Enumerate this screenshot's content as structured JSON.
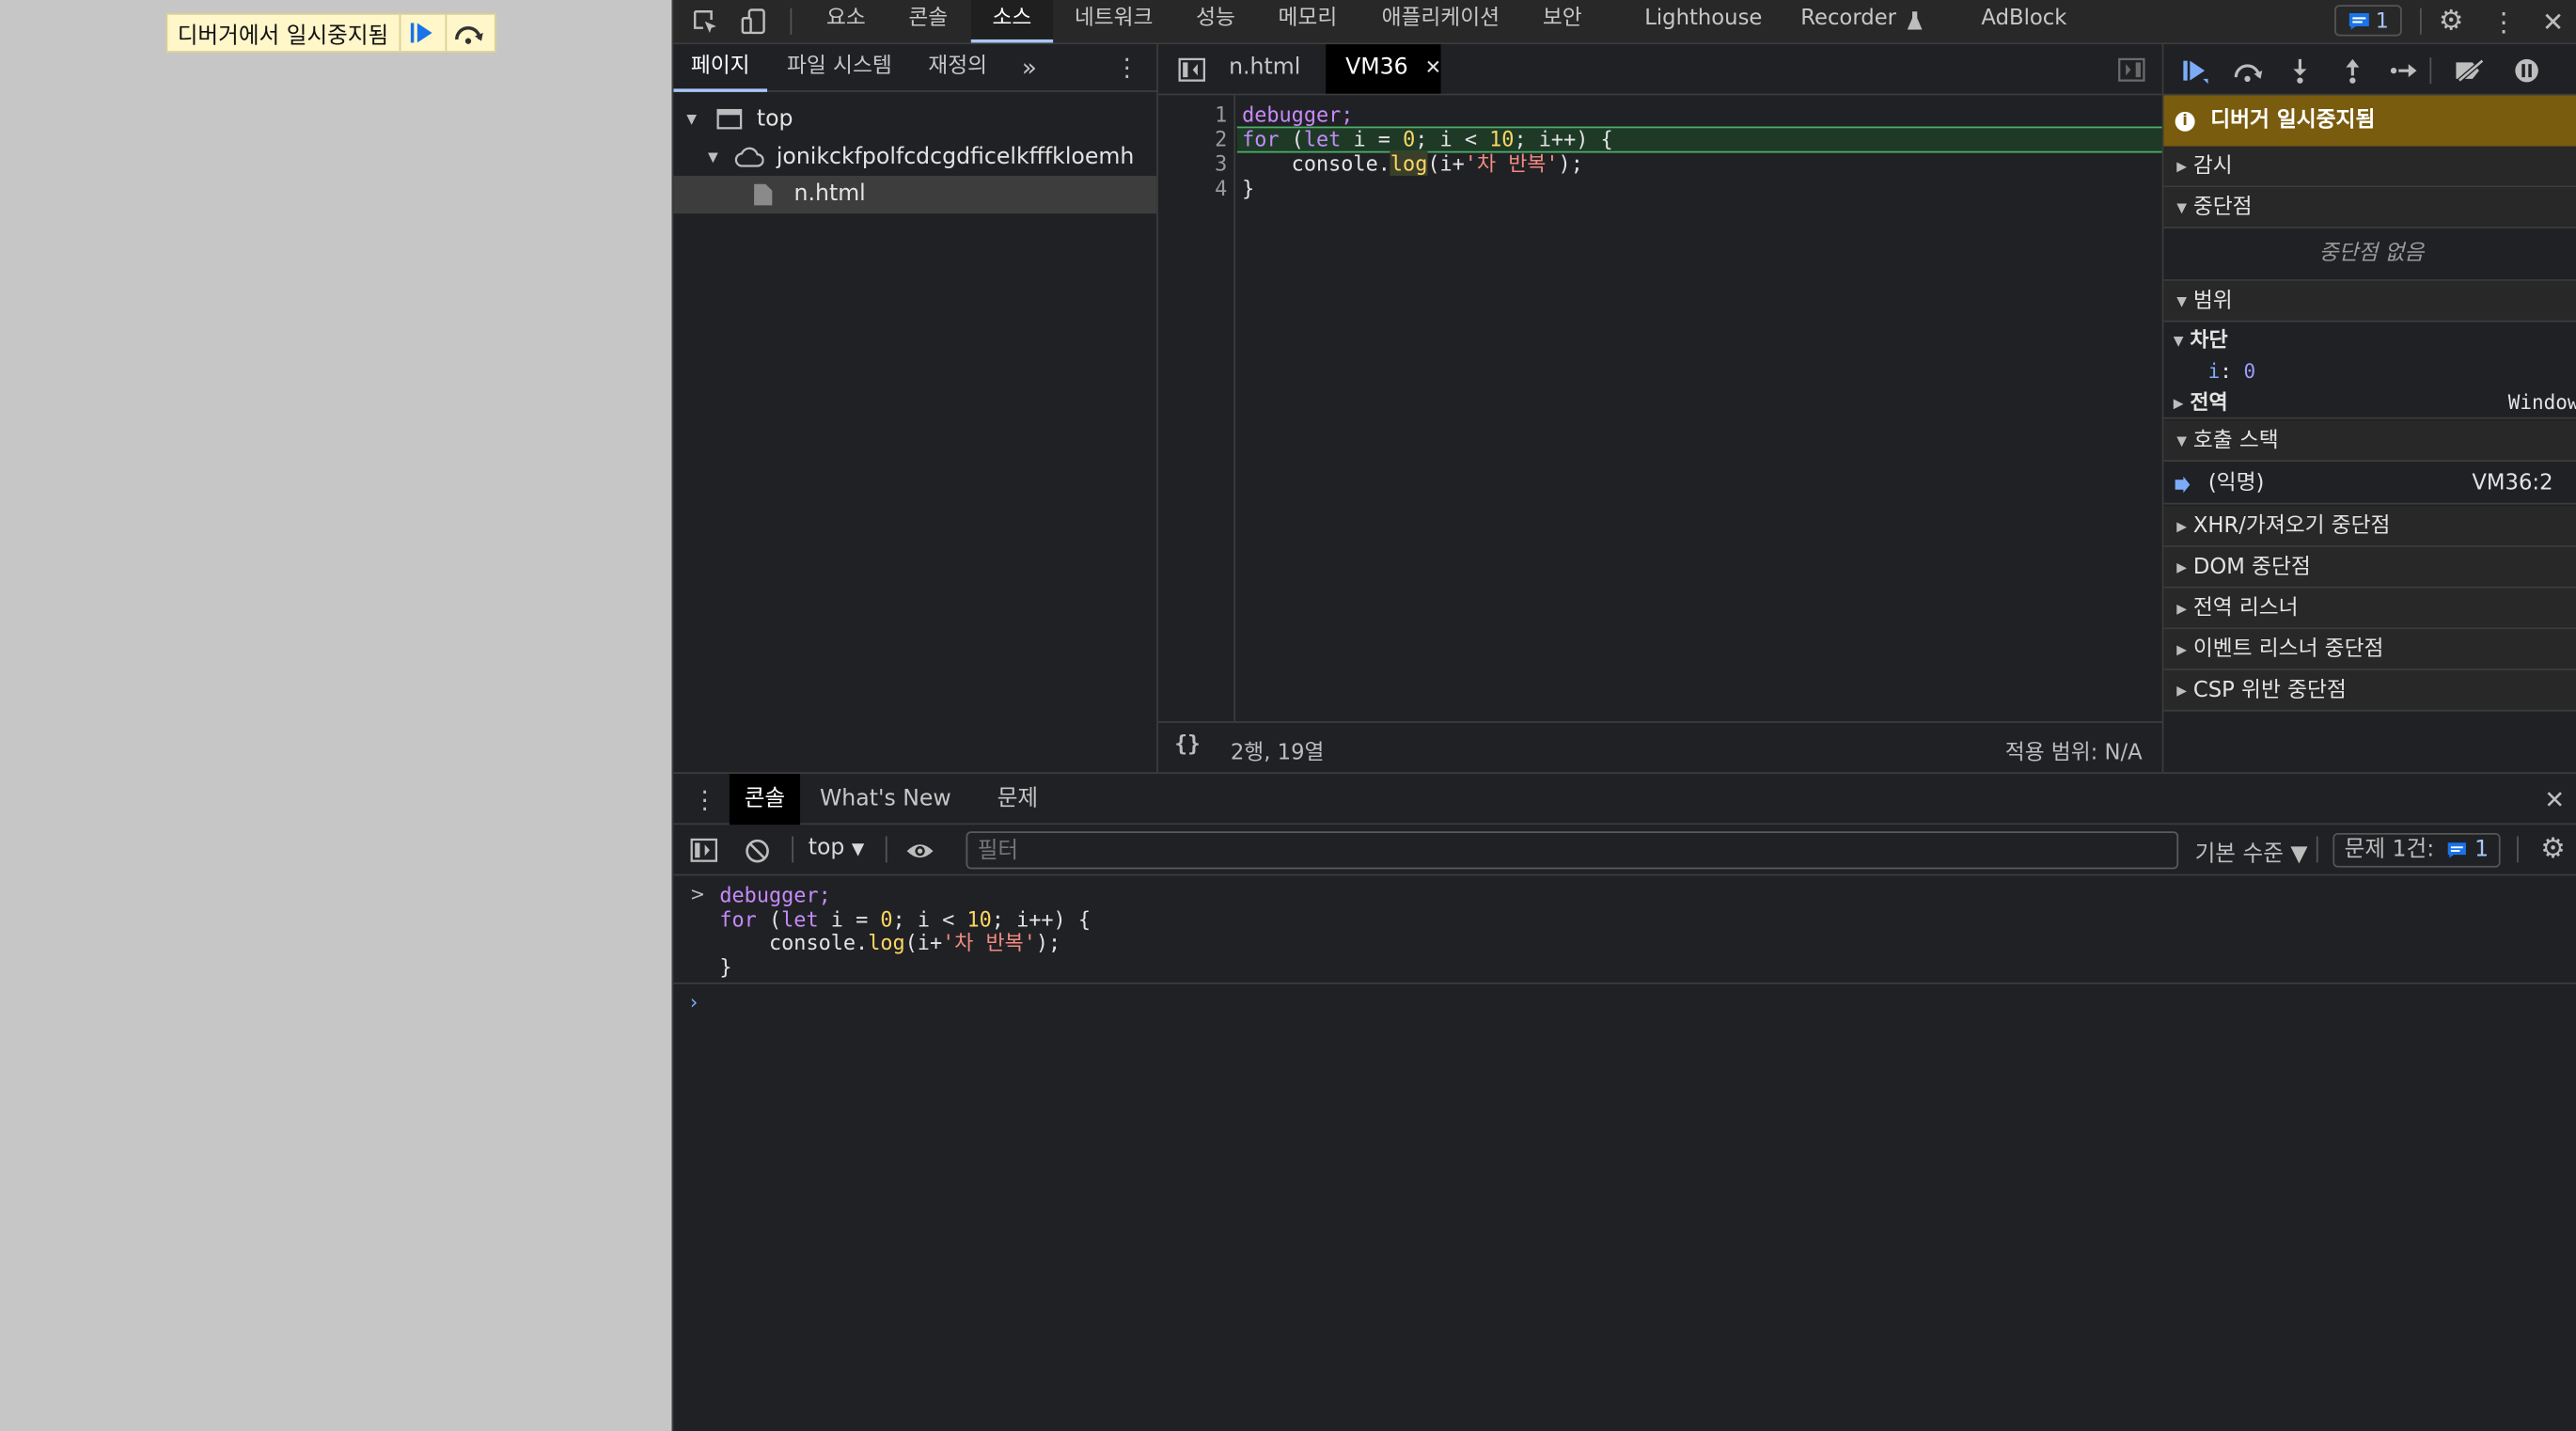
{
  "page": {
    "paused_banner": {
      "text": "디버거에서 일시중지됨",
      "resume_icon": "resume-icon",
      "step_over_icon": "step-over-icon"
    }
  },
  "toolbar": {
    "tabs": [
      "요소",
      "콘솔",
      "소스",
      "네트워크",
      "성능",
      "메모리",
      "애플리케이션",
      "보안",
      "Lighthouse",
      "Recorder",
      "AdBlock"
    ],
    "selected_tab": "소스",
    "issues_badge": "1"
  },
  "navigator": {
    "tabs": [
      "페이지",
      "파일 시스템",
      "재정의"
    ],
    "more": "»",
    "tree": {
      "top": "top",
      "origin": "jonikckfpolfcdcgdficelkfffkloemh",
      "file": "n.html"
    }
  },
  "editor": {
    "tabs": [
      "n.html",
      "VM36"
    ],
    "active_tab": "VM36",
    "line_numbers": [
      "1",
      "2",
      "3",
      "4"
    ],
    "code": {
      "l1": "debugger;",
      "l2_for": "for",
      "l2_a": " (",
      "l2_let": "let",
      "l2_b": " i = ",
      "l2_zero": "0",
      "l2_c": "; i < ",
      "l2_ten": "10",
      "l2_d": "; i++) {",
      "l3_a": "    console.",
      "l3_log": "log",
      "l3_b": "(i+",
      "l3_str": "'차 반복'",
      "l3_c": ");",
      "l4": "}"
    },
    "status": {
      "braces": "{}",
      "position": "2행, 19열",
      "coverage": "적용 범위: N/A"
    }
  },
  "sidebar": {
    "paused_header": "디버거 일시중지됨",
    "watch": "감시",
    "breakpoints": "중단점",
    "no_breakpoints": "중단점 없음",
    "scope": "범위",
    "block": "차단",
    "var_name": "i",
    "var_value": "0",
    "global": "전역",
    "global_value": "Window",
    "call_stack": "호출 스택",
    "frame_name": "(익명)",
    "frame_location": "VM36:2",
    "xhr": "XHR/가져오기 중단점",
    "dom": "DOM 중단점",
    "global_listeners": "전역 리스너",
    "event_listeners": "이벤트 리스너 중단점",
    "csp": "CSP 위반 중단점"
  },
  "drawer": {
    "tabs": [
      "콘솔",
      "What's New",
      "문제"
    ],
    "context": "top",
    "filter_placeholder": "필터",
    "level": "기본 수준 ▼",
    "issues_label": "문제 1건:",
    "issues_count": "1",
    "console": {
      "l1": "debugger;",
      "l2_for": "for",
      "l2_a": " (",
      "l2_let": "let",
      "l2_b": " i = ",
      "l2_zero": "0",
      "l2_c": "; i < ",
      "l2_ten": "10",
      "l2_d": "; i++) {",
      "l3_a": "    console.",
      "l3_log": "log",
      "l3_b": "(i+",
      "l3_str": "'차 반복'",
      "l3_c": ");",
      "l4": "}"
    }
  },
  "colors": {
    "accent": "#a8c7fa",
    "paused_bg": "#7a5c0e",
    "banner_bg": "#fff6c9",
    "current_line": "#1e3a26"
  }
}
